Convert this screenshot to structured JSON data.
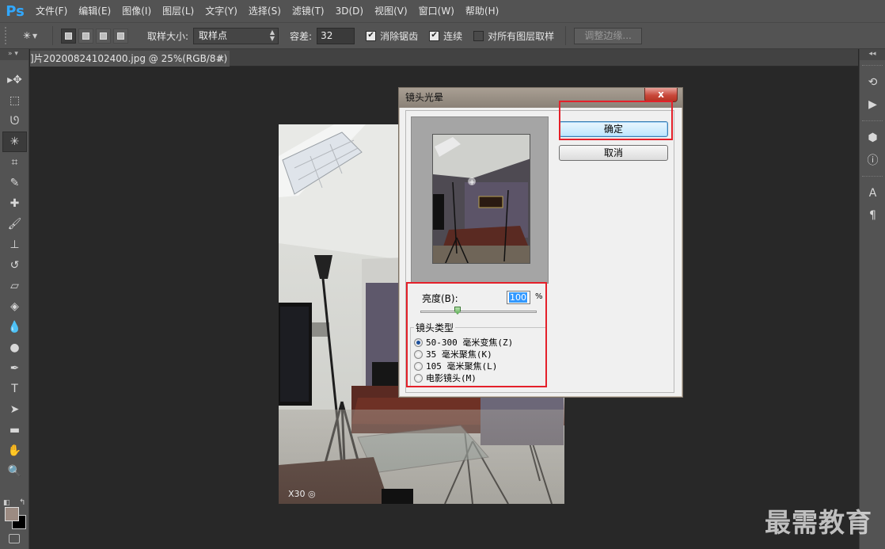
{
  "app": {
    "logo": "Ps"
  },
  "menu": [
    "文件(F)",
    "编辑(E)",
    "图像(I)",
    "图层(L)",
    "文字(Y)",
    "选择(S)",
    "滤镜(T)",
    "3D(D)",
    "视图(V)",
    "窗口(W)",
    "帮助(H)"
  ],
  "options": {
    "sample_size_label": "取样大小:",
    "sample_size_value": "取样点",
    "tolerance_label": "容差:",
    "tolerance_value": "32",
    "antialias_label": "消除锯齿",
    "antialias_checked": true,
    "contiguous_label": "连续",
    "contiguous_checked": true,
    "all_layers_label": "对所有图层取样",
    "all_layers_checked": false,
    "refine_edge_label": "调整边缘..."
  },
  "left_panel": {
    "header": "» ▾"
  },
  "tools": [
    {
      "name": "move-tool-icon",
      "glyph": "▸✥"
    },
    {
      "name": "marquee-tool-icon",
      "glyph": "⬚"
    },
    {
      "name": "lasso-tool-icon",
      "glyph": "ᘎ"
    },
    {
      "name": "magic-wand-tool-icon",
      "glyph": "✳"
    },
    {
      "name": "crop-tool-icon",
      "glyph": "⌗"
    },
    {
      "name": "eyedropper-tool-icon",
      "glyph": "✎"
    },
    {
      "name": "healing-brush-tool-icon",
      "glyph": "✚"
    },
    {
      "name": "brush-tool-icon",
      "glyph": "🖌"
    },
    {
      "name": "clone-stamp-tool-icon",
      "glyph": "⊥"
    },
    {
      "name": "history-brush-tool-icon",
      "glyph": "↺"
    },
    {
      "name": "eraser-tool-icon",
      "glyph": "▱"
    },
    {
      "name": "paint-bucket-tool-icon",
      "glyph": "◈"
    },
    {
      "name": "blur-tool-icon",
      "glyph": "💧"
    },
    {
      "name": "dodge-tool-icon",
      "glyph": "●"
    },
    {
      "name": "pen-tool-icon",
      "glyph": "✒"
    },
    {
      "name": "type-tool-icon",
      "glyph": "T"
    },
    {
      "name": "path-selection-tool-icon",
      "glyph": "➤"
    },
    {
      "name": "rectangle-tool-icon",
      "glyph": "▬"
    },
    {
      "name": "hand-tool-icon",
      "glyph": "✋"
    },
    {
      "name": "zoom-tool-icon",
      "glyph": "🔍"
    }
  ],
  "colors": {
    "foreground": "#9c8b82",
    "background": "#000000",
    "highlight": "#e4202a"
  },
  "document_tab": {
    "title": "]片20200824102400.jpg @ 25%(RGB/8#) *",
    "close": "×"
  },
  "right_strip": {
    "icons": [
      "history-icon",
      "actions-play-icon",
      "3d-icon",
      "info-icon",
      "character-icon",
      "paragraph-icon"
    ]
  },
  "photo": {
    "badge": "X30 ◎"
  },
  "dialog": {
    "title": "镜头光晕",
    "close": "x",
    "ok_label": "确定",
    "cancel_label": "取消",
    "brightness_label": "亮度(B):",
    "brightness_value": "100",
    "percent": "%",
    "lens_type_label": "镜头类型",
    "lens_options": [
      {
        "label": "50-300 毫米变焦(Z)",
        "selected": true
      },
      {
        "label": "35 毫米聚焦(K)",
        "selected": false
      },
      {
        "label": "105 毫米聚焦(L)",
        "selected": false
      },
      {
        "label": "电影镜头(M)",
        "selected": false
      }
    ]
  },
  "watermark": "最需教育"
}
